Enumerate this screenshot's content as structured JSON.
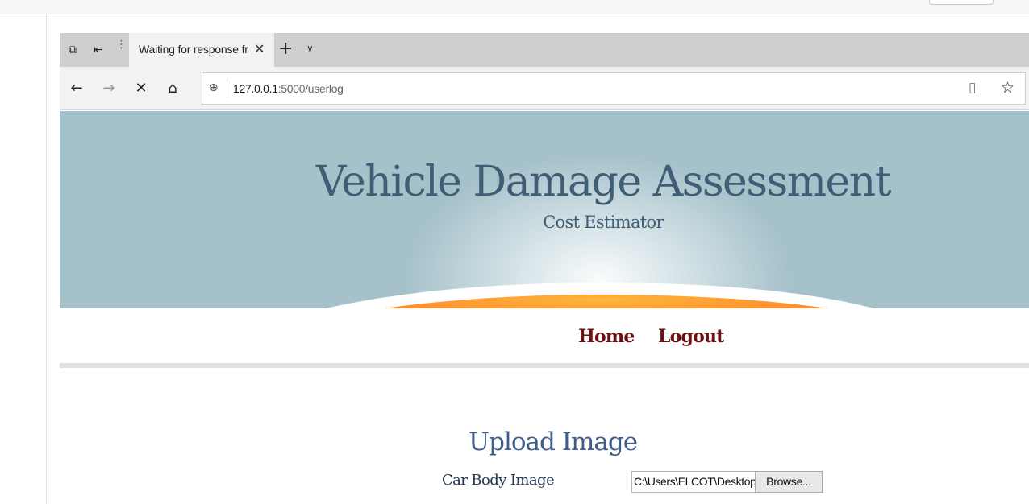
{
  "browser": {
    "tab_title": "Waiting for response fro",
    "tab_close": "✕",
    "new_tab": "+",
    "tab_list": "∨",
    "nav": {
      "back": "←",
      "forward": "→",
      "stop": "✕",
      "home": "⌂"
    },
    "address": {
      "host": "127.0.0.1",
      "path": ":5000/userlog"
    },
    "reading_view": "▯",
    "favorite": "☆"
  },
  "site": {
    "title": "Vehicle Damage Assessment",
    "subtitle": "Cost Estimator",
    "menu": [
      {
        "label": "Home"
      },
      {
        "label": "Logout"
      }
    ]
  },
  "upload": {
    "heading": "Upload Image",
    "field_label": "Car Body Image",
    "file_value": "C:\\Users\\ELCOT\\Desktop",
    "browse_label": "Browse..."
  },
  "colors": {
    "banner_blue": "#a5c1ca",
    "title_text": "#3f5d74",
    "menu_orange": "#ff5a22",
    "menu_glow": "#ffb63a",
    "menu_text": "#6b1111",
    "heading_text": "#3f5d8a"
  }
}
